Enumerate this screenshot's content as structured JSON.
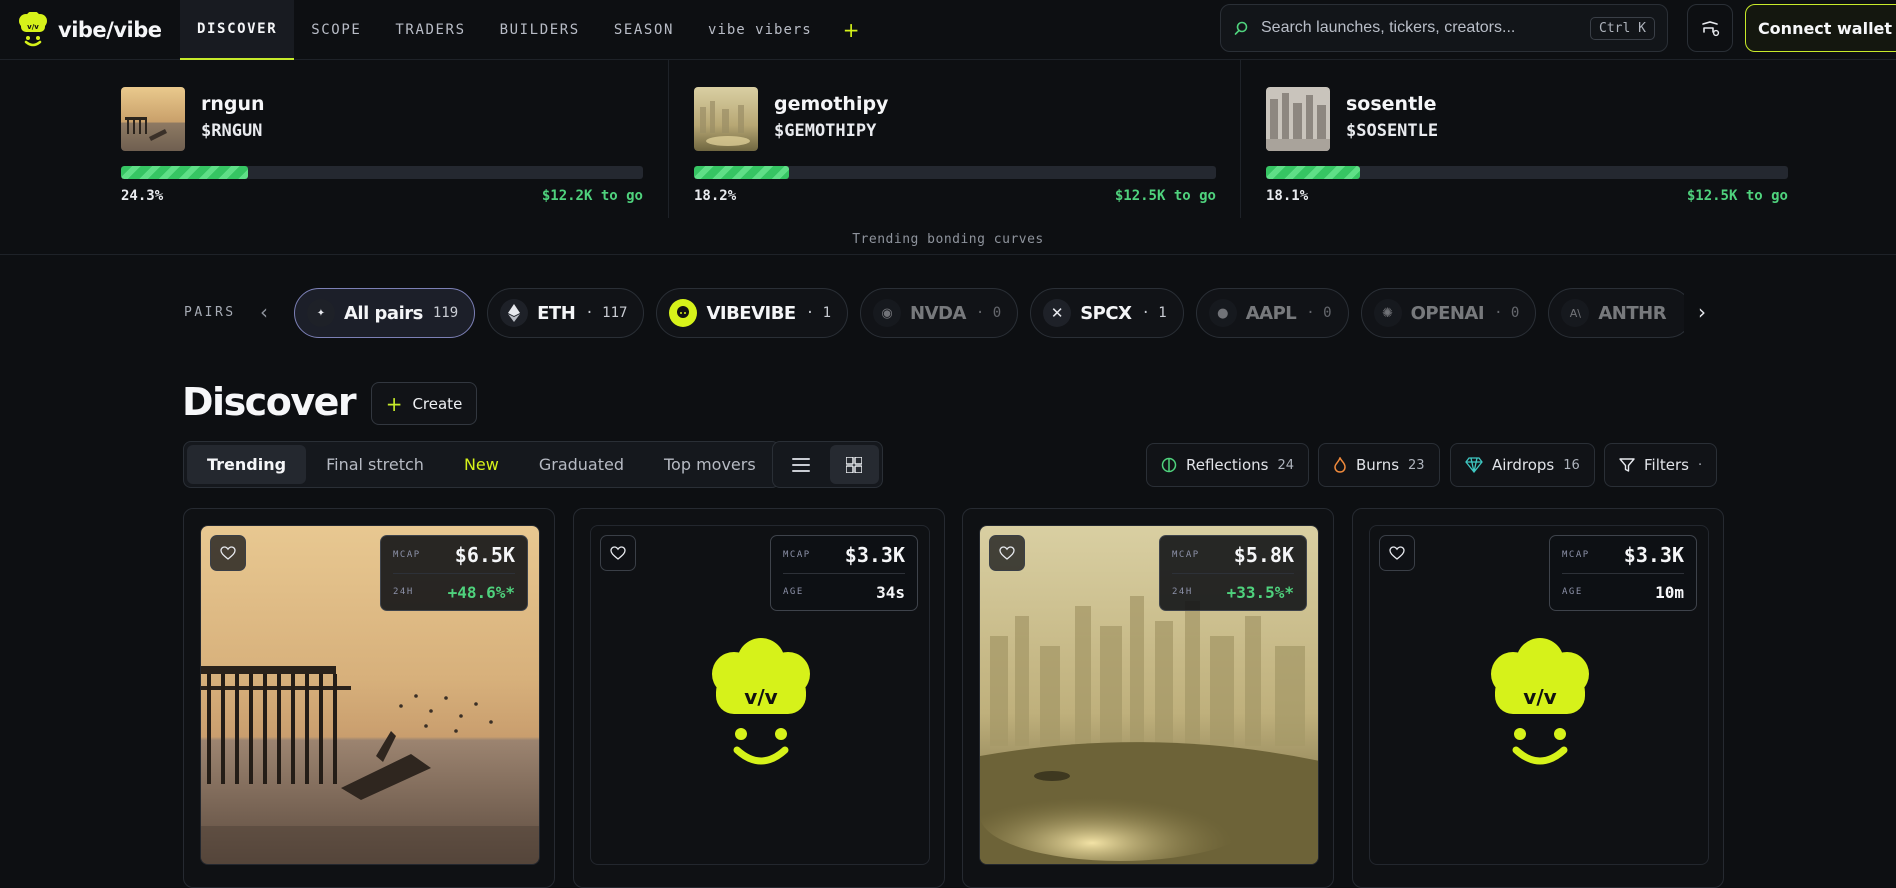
{
  "brand": {
    "name": "vibe/vibe"
  },
  "nav": {
    "tabs": [
      {
        "label": "DISCOVER"
      },
      {
        "label": "SCOPE"
      },
      {
        "label": "TRADERS"
      },
      {
        "label": "BUILDERS"
      },
      {
        "label": "SEASON"
      },
      {
        "label": "vibe vibers"
      }
    ],
    "plus": "+"
  },
  "search": {
    "placeholder": "Search launches, tickers, creators...",
    "shortcut": "Ctrl K"
  },
  "connect_label": "Connect wallet",
  "trending": {
    "caption": "Trending bonding curves",
    "items": [
      {
        "name": "rngun",
        "ticker": "$RNGUN",
        "progress_pct": "24.3%",
        "progress": 0.243,
        "to_go": "$12.2K to go"
      },
      {
        "name": "gemothipy",
        "ticker": "$GEMOTHIPY",
        "progress_pct": "18.2%",
        "progress": 0.182,
        "to_go": "$12.5K to go"
      },
      {
        "name": "sosentle",
        "ticker": "$SOSENTLE",
        "progress_pct": "18.1%",
        "progress": 0.181,
        "to_go": "$12.5K to go"
      }
    ]
  },
  "pairs": {
    "label": "PAIRS",
    "items": [
      {
        "name": "All pairs",
        "count": "119"
      },
      {
        "name": "ETH",
        "count": "· 117"
      },
      {
        "name": "VIBEVIBE",
        "count": "· 1"
      },
      {
        "name": "NVDA",
        "count": "· 0"
      },
      {
        "name": "SPCX",
        "count": "· 1"
      },
      {
        "name": "AAPL",
        "count": "· 0"
      },
      {
        "name": "OPENAI",
        "count": "· 0"
      },
      {
        "name": "ANTHR",
        "count": ""
      }
    ]
  },
  "discover": {
    "title": "Discover",
    "create_label": "Create",
    "tabs": [
      {
        "label": "Trending"
      },
      {
        "label": "Final stretch"
      },
      {
        "label": "New"
      },
      {
        "label": "Graduated"
      },
      {
        "label": "Top movers"
      }
    ],
    "chips": [
      {
        "label": "Reflections",
        "count": "24"
      },
      {
        "label": "Burns",
        "count": "23"
      },
      {
        "label": "Airdrops",
        "count": "16"
      },
      {
        "label": "Filters",
        "count": "·"
      }
    ]
  },
  "cards": [
    {
      "mcap_label": "MCAP",
      "mcap": "$6.5K",
      "stat2_label": "24H",
      "stat2": "+48.6%*"
    },
    {
      "mcap_label": "MCAP",
      "mcap": "$3.3K",
      "stat2_label": "AGE",
      "stat2": "34s"
    },
    {
      "mcap_label": "MCAP",
      "mcap": "$5.8K",
      "stat2_label": "24H",
      "stat2": "+33.5%*"
    },
    {
      "mcap_label": "MCAP",
      "mcap": "$3.3K",
      "stat2_label": "AGE",
      "stat2": "10m"
    }
  ],
  "colors": {
    "accent": "#c6ea2a",
    "positive": "#4fd27d",
    "progress": "#36c563",
    "background": "#0d0f12"
  }
}
